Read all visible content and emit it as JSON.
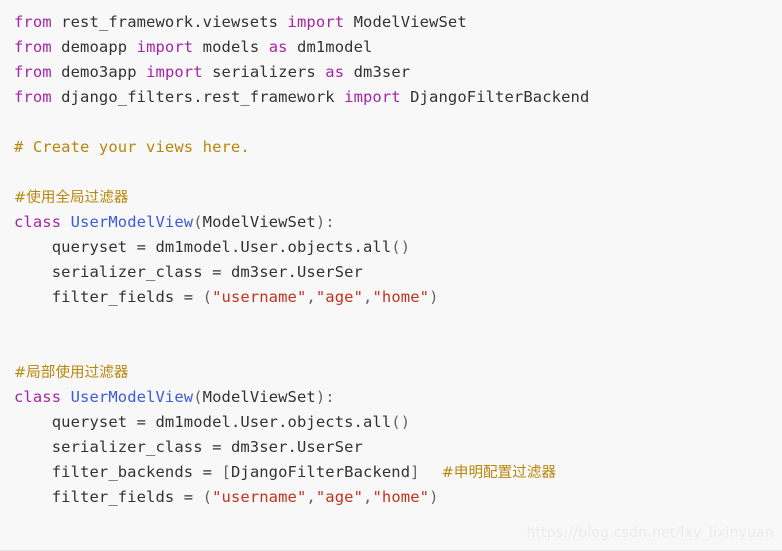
{
  "code_block": {
    "language": "python",
    "background_color": "#f8f8f8",
    "colors": {
      "keyword": "#a625a6",
      "class_name": "#3b5bdb",
      "string": "#c0341d",
      "comment": "#b8860b",
      "plain_text": "#333333",
      "punctuation": "#666666",
      "watermark": "#ececec"
    },
    "lines": [
      {
        "index": 1,
        "text": "from rest_framework.viewsets import ModelViewSet",
        "tokens": [
          {
            "t": "from",
            "c": "keyword"
          },
          {
            "t": " ",
            "c": "plain"
          },
          {
            "t": "rest_framework.viewsets",
            "c": "plain"
          },
          {
            "t": " ",
            "c": "plain"
          },
          {
            "t": "import",
            "c": "keyword"
          },
          {
            "t": " ",
            "c": "plain"
          },
          {
            "t": "ModelViewSet",
            "c": "plain"
          }
        ]
      },
      {
        "index": 2,
        "text": "from demoapp import models as dm1model",
        "tokens": [
          {
            "t": "from",
            "c": "keyword"
          },
          {
            "t": " ",
            "c": "plain"
          },
          {
            "t": "demoapp",
            "c": "plain"
          },
          {
            "t": " ",
            "c": "plain"
          },
          {
            "t": "import",
            "c": "keyword"
          },
          {
            "t": " ",
            "c": "plain"
          },
          {
            "t": "models",
            "c": "plain"
          },
          {
            "t": " ",
            "c": "plain"
          },
          {
            "t": "as",
            "c": "keyword"
          },
          {
            "t": " ",
            "c": "plain"
          },
          {
            "t": "dm1model",
            "c": "plain"
          }
        ]
      },
      {
        "index": 3,
        "text": "from demo3app import serializers as dm3ser",
        "tokens": [
          {
            "t": "from",
            "c": "keyword"
          },
          {
            "t": " ",
            "c": "plain"
          },
          {
            "t": "demo3app",
            "c": "plain"
          },
          {
            "t": " ",
            "c": "plain"
          },
          {
            "t": "import",
            "c": "keyword"
          },
          {
            "t": " ",
            "c": "plain"
          },
          {
            "t": "serializers",
            "c": "plain"
          },
          {
            "t": " ",
            "c": "plain"
          },
          {
            "t": "as",
            "c": "keyword"
          },
          {
            "t": " ",
            "c": "plain"
          },
          {
            "t": "dm3ser",
            "c": "plain"
          }
        ]
      },
      {
        "index": 4,
        "text": "from django_filters.rest_framework import DjangoFilterBackend",
        "tokens": [
          {
            "t": "from",
            "c": "keyword"
          },
          {
            "t": " ",
            "c": "plain"
          },
          {
            "t": "django_filters.rest_framework",
            "c": "plain"
          },
          {
            "t": " ",
            "c": "plain"
          },
          {
            "t": "import",
            "c": "keyword"
          },
          {
            "t": " ",
            "c": "plain"
          },
          {
            "t": "DjangoFilterBackend",
            "c": "plain"
          }
        ]
      },
      {
        "index": 5,
        "text": "",
        "tokens": []
      },
      {
        "index": 6,
        "text": "# Create your views here.",
        "tokens": [
          {
            "t": "# Create your views here.",
            "c": "comment"
          }
        ]
      },
      {
        "index": 7,
        "text": "",
        "tokens": []
      },
      {
        "index": 8,
        "text": "#使用全局过滤器",
        "tokens": [
          {
            "t": "#使用全局过滤器",
            "c": "comment-cn"
          }
        ]
      },
      {
        "index": 9,
        "text": "class UserModelView(ModelViewSet):",
        "tokens": [
          {
            "t": "class",
            "c": "keyword"
          },
          {
            "t": " ",
            "c": "plain"
          },
          {
            "t": "UserModelView",
            "c": "class_name"
          },
          {
            "t": "(",
            "c": "punctuation"
          },
          {
            "t": "ModelViewSet",
            "c": "plain"
          },
          {
            "t": ")",
            "c": "punctuation"
          },
          {
            "t": ":",
            "c": "punctuation"
          }
        ]
      },
      {
        "index": 10,
        "text": "    queryset = dm1model.User.objects.all()",
        "tokens": [
          {
            "t": "    queryset ",
            "c": "plain"
          },
          {
            "t": "=",
            "c": "operator"
          },
          {
            "t": " dm1model.User.objects.all",
            "c": "plain"
          },
          {
            "t": "()",
            "c": "punctuation"
          }
        ]
      },
      {
        "index": 11,
        "text": "    serializer_class = dm3ser.UserSer",
        "tokens": [
          {
            "t": "    serializer_class ",
            "c": "plain"
          },
          {
            "t": "=",
            "c": "operator"
          },
          {
            "t": " dm3ser.UserSer",
            "c": "plain"
          }
        ]
      },
      {
        "index": 12,
        "text": "    filter_fields = (\"username\",\"age\",\"home\")",
        "tokens": [
          {
            "t": "    filter_fields ",
            "c": "plain"
          },
          {
            "t": "=",
            "c": "operator"
          },
          {
            "t": " (",
            "c": "punctuation"
          },
          {
            "t": "\"username\"",
            "c": "string"
          },
          {
            "t": ",",
            "c": "punctuation"
          },
          {
            "t": "\"age\"",
            "c": "string"
          },
          {
            "t": ",",
            "c": "punctuation"
          },
          {
            "t": "\"home\"",
            "c": "string"
          },
          {
            "t": ")",
            "c": "punctuation"
          }
        ]
      },
      {
        "index": 13,
        "text": "",
        "tokens": []
      },
      {
        "index": 14,
        "text": "",
        "tokens": []
      },
      {
        "index": 15,
        "text": "#局部使用过滤器",
        "tokens": [
          {
            "t": "#局部使用过滤器",
            "c": "comment-cn"
          }
        ]
      },
      {
        "index": 16,
        "text": "class UserModelView(ModelViewSet):",
        "tokens": [
          {
            "t": "class",
            "c": "keyword"
          },
          {
            "t": " ",
            "c": "plain"
          },
          {
            "t": "UserModelView",
            "c": "class_name"
          },
          {
            "t": "(",
            "c": "punctuation"
          },
          {
            "t": "ModelViewSet",
            "c": "plain"
          },
          {
            "t": ")",
            "c": "punctuation"
          },
          {
            "t": ":",
            "c": "punctuation"
          }
        ]
      },
      {
        "index": 17,
        "text": "    queryset = dm1model.User.objects.all()",
        "tokens": [
          {
            "t": "    queryset ",
            "c": "plain"
          },
          {
            "t": "=",
            "c": "operator"
          },
          {
            "t": " dm1model.User.objects.all",
            "c": "plain"
          },
          {
            "t": "()",
            "c": "punctuation"
          }
        ]
      },
      {
        "index": 18,
        "text": "    serializer_class = dm3ser.UserSer",
        "tokens": [
          {
            "t": "    serializer_class ",
            "c": "plain"
          },
          {
            "t": "=",
            "c": "operator"
          },
          {
            "t": " dm3ser.UserSer",
            "c": "plain"
          }
        ]
      },
      {
        "index": 19,
        "text": "    filter_backends = [DjangoFilterBackend]   #申明配置过滤器",
        "tokens": [
          {
            "t": "    filter_backends ",
            "c": "plain"
          },
          {
            "t": "=",
            "c": "operator"
          },
          {
            "t": " [",
            "c": "punctuation"
          },
          {
            "t": "DjangoFilterBackend",
            "c": "plain"
          },
          {
            "t": "]",
            "c": "punctuation"
          },
          {
            "t": "GAP",
            "c": "gap"
          },
          {
            "t": "#申明配置过滤器",
            "c": "comment-cn"
          }
        ]
      },
      {
        "index": 20,
        "text": "    filter_fields = (\"username\",\"age\",\"home\")",
        "tokens": [
          {
            "t": "    filter_fields ",
            "c": "plain"
          },
          {
            "t": "=",
            "c": "operator"
          },
          {
            "t": " (",
            "c": "punctuation"
          },
          {
            "t": "\"username\"",
            "c": "string"
          },
          {
            "t": ",",
            "c": "punctuation"
          },
          {
            "t": "\"age\"",
            "c": "string"
          },
          {
            "t": ",",
            "c": "punctuation"
          },
          {
            "t": "\"home\"",
            "c": "string"
          },
          {
            "t": ")",
            "c": "punctuation"
          }
        ]
      },
      {
        "index": 21,
        "text": "",
        "tokens": []
      }
    ]
  },
  "watermark": {
    "text": "https://blog.csdn.net/lxy_lixinyuan"
  }
}
